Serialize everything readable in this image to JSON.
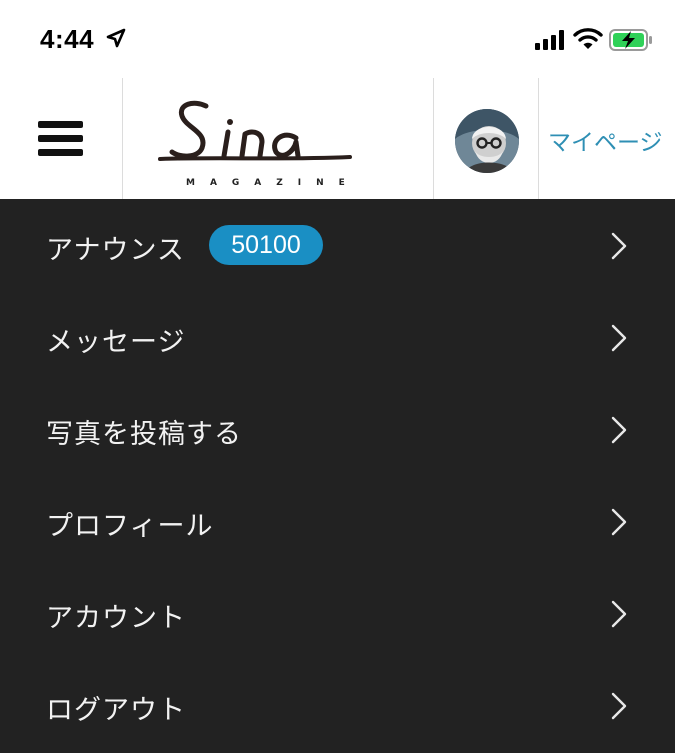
{
  "status_bar": {
    "time": "4:44",
    "icons": [
      "location-arrow-icon",
      "cellular-signal-icon",
      "wifi-icon",
      "battery-charging-icon"
    ]
  },
  "header": {
    "logo_text": "Sina",
    "logo_subtext": "MAGAZINE",
    "mypage_label": "マイページ",
    "accent_color": "#2e8fb4"
  },
  "menu": {
    "background_color": "#222222",
    "badge_color": "#1a8fc4",
    "items": [
      {
        "label": "アナウンス",
        "badge": "50100"
      },
      {
        "label": "メッセージ"
      },
      {
        "label": "写真を投稿する"
      },
      {
        "label": "プロフィール"
      },
      {
        "label": "アカウント"
      },
      {
        "label": "ログアウト"
      }
    ]
  }
}
